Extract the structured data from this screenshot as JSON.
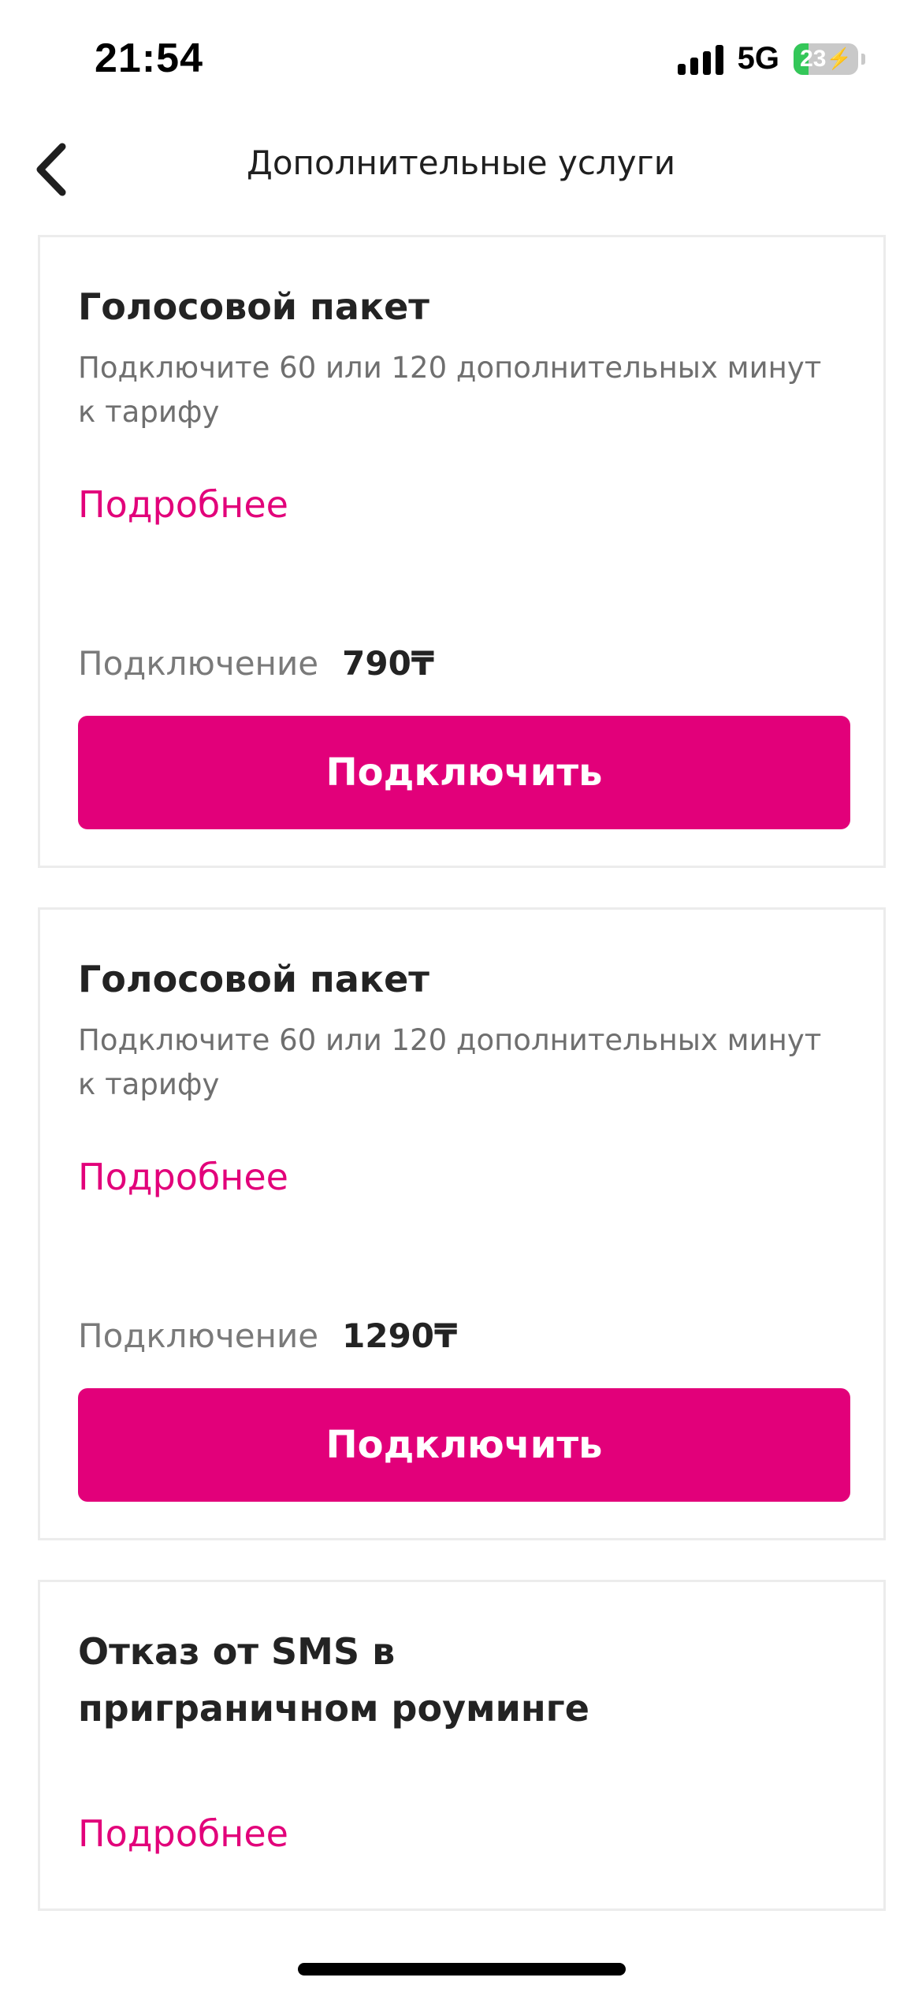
{
  "status_bar": {
    "time": "21:54",
    "network": "5G",
    "battery_percent": "23",
    "battery_level": 0.23
  },
  "header": {
    "title": "Дополнительные услуги",
    "back_icon": "chevron-left-icon"
  },
  "colors": {
    "accent": "#e2007a",
    "text": "#232323",
    "muted": "#6f6f6f"
  },
  "cards": [
    {
      "title": "Голосовой пакет",
      "description": "Подключите 60 или 120 дополнительных минут к тарифу",
      "details_label": "Подробнее",
      "price_label": "Подключение",
      "price_value": "790₸",
      "button_label": "Подключить"
    },
    {
      "title": "Голосовой пакет",
      "description": "Подключите 60 или 120 дополнительных минут к тарифу",
      "details_label": "Подробнее",
      "price_label": "Подключение",
      "price_value": "1290₸",
      "button_label": "Подключить"
    },
    {
      "title": "Отказ от SMS в приграничном роуминге",
      "details_label": "Подробнее"
    }
  ]
}
